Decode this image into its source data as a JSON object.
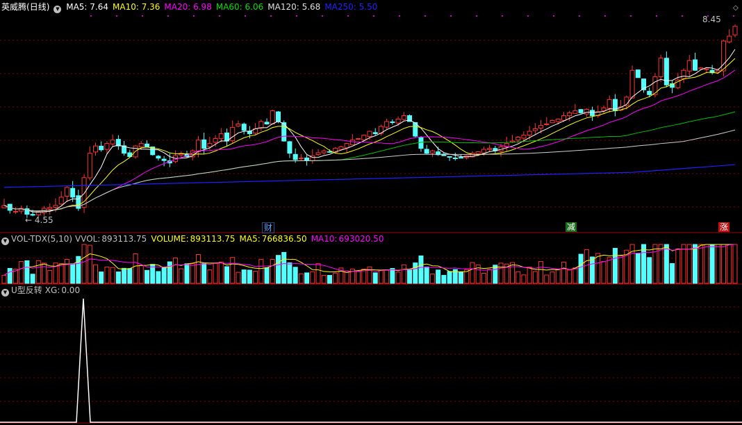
{
  "main_header": {
    "name": "英威腾",
    "period": "(日线)",
    "ma": [
      {
        "label": "MA5:",
        "value": "7.64",
        "color": "#ffffff"
      },
      {
        "label": "MA10:",
        "value": "7.36",
        "color": "#ffff00"
      },
      {
        "label": "MA20:",
        "value": "6.98",
        "color": "#ff00ff"
      },
      {
        "label": "MA60:",
        "value": "6.06",
        "color": "#00e000"
      },
      {
        "label": "MA120:",
        "value": "5.68",
        "color": "#e0e0e0"
      },
      {
        "label": "MA250:",
        "value": "5.50",
        "color": "#2020ff"
      }
    ]
  },
  "high_label": "8.45",
  "low_label": "4.55",
  "markers": {
    "fin": "财",
    "cut": "减",
    "up": "涨"
  },
  "vol_header": {
    "title": "VOL-TDX(5,10)",
    "vvol_label": "VVOL:",
    "vvol": "893113.75",
    "volume_label": "VOLUME:",
    "volume": "893113.75",
    "ma5_label": "MA5:",
    "ma5": "766836.50",
    "ma10_label": "MA10:",
    "ma10": "693020.50"
  },
  "ind_header": {
    "title": "U型反转",
    "xg_label": "XG:",
    "xg": "0.00"
  },
  "colors": {
    "up": "#ff3232",
    "down": "#54ffff",
    "bg": "#000000",
    "grid": "#800000"
  },
  "closes": [
    4.78,
    4.68,
    4.66,
    4.72,
    4.6,
    4.58,
    4.65,
    4.72,
    4.74,
    4.78,
    4.95,
    5.15,
    4.95,
    4.72,
    5.35,
    5.85,
    6.0,
    5.92,
    6.05,
    6.12,
    6.0,
    5.85,
    5.78,
    6.0,
    6.05,
    5.98,
    5.82,
    5.75,
    5.7,
    5.65,
    5.8,
    5.85,
    5.78,
    5.9,
    6.12,
    5.95,
    6.05,
    6.15,
    6.25,
    6.1,
    6.38,
    6.45,
    6.32,
    6.25,
    6.35,
    6.5,
    6.45,
    6.72,
    6.5,
    6.1,
    5.85,
    5.72,
    5.75,
    5.7,
    5.8,
    5.86,
    5.9,
    5.88,
    5.95,
    5.98,
    6.05,
    6.12,
    6.15,
    6.22,
    6.3,
    6.25,
    6.4,
    6.5,
    6.48,
    6.55,
    6.62,
    6.5,
    6.2,
    5.95,
    5.85,
    5.9,
    5.82,
    5.8,
    5.78,
    5.75,
    5.76,
    5.8,
    5.85,
    5.88,
    5.93,
    5.95,
    5.9,
    5.98,
    6.05,
    6.1,
    6.18,
    6.22,
    6.3,
    6.35,
    6.42,
    6.45,
    6.52,
    6.55,
    6.62,
    6.68,
    6.72,
    6.68,
    6.75,
    6.62,
    6.7,
    6.78,
    6.95,
    6.72,
    6.8,
    7.0,
    7.55,
    7.4,
    7.15,
    7.05,
    7.42,
    7.8,
    7.25,
    7.2,
    7.35,
    7.55,
    7.75,
    7.55,
    7.6,
    7.58,
    7.5,
    7.55,
    8.15,
    8.25,
    8.45
  ]
}
